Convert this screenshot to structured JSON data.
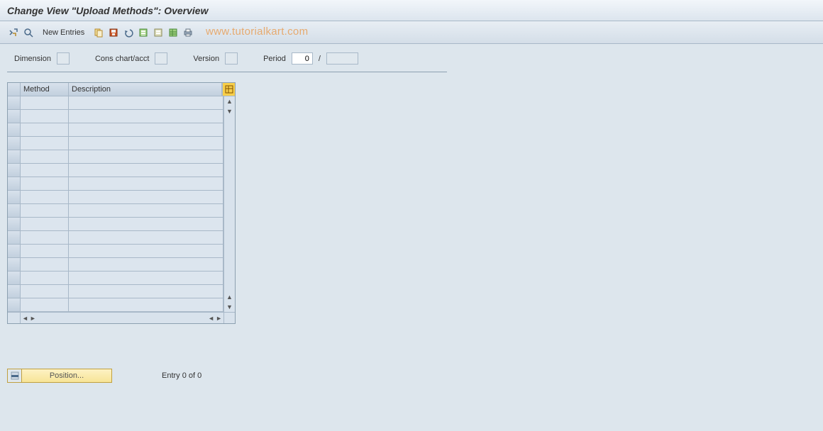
{
  "title": "Change View \"Upload Methods\": Overview",
  "toolbar": {
    "new_entries": "New Entries"
  },
  "watermark": "www.tutorialkart.com",
  "filters": {
    "dimension_label": "Dimension",
    "cons_label": "Cons chart/acct",
    "version_label": "Version",
    "period_label": "Period",
    "period_value": "0",
    "slash": "/"
  },
  "table": {
    "col_method": "Method",
    "col_description": "Description",
    "rows": [
      {
        "method": "",
        "description": ""
      },
      {
        "method": "",
        "description": ""
      },
      {
        "method": "",
        "description": ""
      },
      {
        "method": "",
        "description": ""
      },
      {
        "method": "",
        "description": ""
      },
      {
        "method": "",
        "description": ""
      },
      {
        "method": "",
        "description": ""
      },
      {
        "method": "",
        "description": ""
      },
      {
        "method": "",
        "description": ""
      },
      {
        "method": "",
        "description": ""
      },
      {
        "method": "",
        "description": ""
      },
      {
        "method": "",
        "description": ""
      },
      {
        "method": "",
        "description": ""
      },
      {
        "method": "",
        "description": ""
      },
      {
        "method": "",
        "description": ""
      },
      {
        "method": "",
        "description": ""
      }
    ]
  },
  "footer": {
    "position_label": "Position...",
    "entry_text": "Entry 0 of 0"
  }
}
